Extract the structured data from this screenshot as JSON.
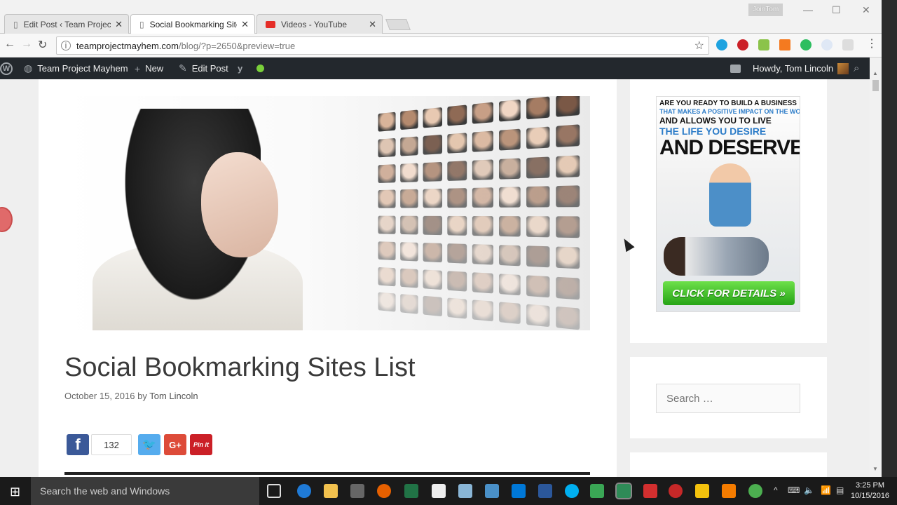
{
  "browser": {
    "tabs": [
      {
        "title": "Edit Post ‹ Team Project ",
        "icon": "page-icon"
      },
      {
        "title": "Social Bookmarking Sites ",
        "icon": "page-icon"
      },
      {
        "title": "Videos - YouTube",
        "icon": "youtube-icon"
      }
    ],
    "window_user": "JoinTom",
    "url_host": "teamprojectmayhem.com",
    "url_path": "/blog/?p=2650&preview=true"
  },
  "adminbar": {
    "site_name": "Team Project Mayhem",
    "new_label": "New",
    "edit_label": "Edit Post",
    "greeting": "Howdy, Tom Lincoln"
  },
  "post": {
    "title": "Social Bookmarking Sites List",
    "date": "October 15, 2016",
    "by": "by",
    "author": "Tom Lincoln",
    "share_count": "132",
    "gplus_label": "G+",
    "pinit_label": "Pin it"
  },
  "sidebar": {
    "ad": {
      "line1": "ARE YOU READY TO BUILD A BUSINESS",
      "line2": "THAT MAKES A POSITIVE IMPACT ON THE WORLD",
      "line3": "AND ALLOWS YOU TO LIVE",
      "line4": "THE LIFE YOU DESIRE",
      "line5": "AND DESERVE?",
      "cta": "CLICK FOR DETAILS »"
    },
    "search_placeholder": "Search …"
  },
  "taskbar": {
    "search_placeholder": "Search the web and Windows",
    "time": "3:25 PM",
    "date": "10/15/2016"
  },
  "colors": {
    "facebook": "#3b5998",
    "twitter": "#55acee",
    "gplus": "#dd4b39",
    "pinterest": "#cb2027",
    "adminbar": "#23282d"
  }
}
